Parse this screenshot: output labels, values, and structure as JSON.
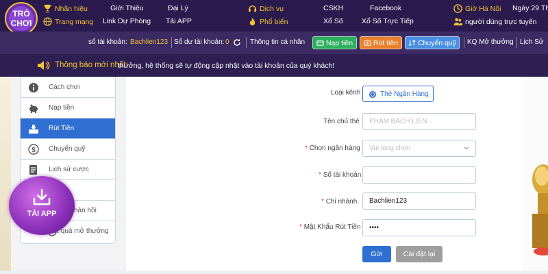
{
  "brand": {
    "logo_text_top": "TRÒ",
    "logo_text_bottom": "CHƠI"
  },
  "topnav": {
    "row1": {
      "nhan_hieu": "Nhãn hiệu",
      "gioi_thieu": "Giới Thiệu",
      "dai_ly": "Đại Lý",
      "dich_vu": "Dịch vụ",
      "cskh": "CSKH",
      "facebook": "Facebook",
      "gio_ha_noi": "Giờ Hà Nội",
      "date": "Ngày 29 Th"
    },
    "row2": {
      "trang_mang": "Trang mạng",
      "link_du_phong": "Link Dự Phòng",
      "tai_app": "Tải APP",
      "pho_bien": "Phổ biến",
      "xo_so": "Xổ Số",
      "xo_so_truc_tiep": "Xổ Số Trực Tiếp",
      "online": "người dùng trực tuyến"
    }
  },
  "userbar": {
    "account_label": "số tài khoản:",
    "account_value": "Bachlien123",
    "balance_label": "Số dư tài khoản:",
    "balance_value": "0",
    "personal_info": "Thông tin cá nhân",
    "deposit": "Nạp tiền",
    "withdraw": "Rút tiền",
    "transfer": "Chuyển quỹ",
    "results": "KQ Mở thưởng",
    "history": "Lịch Sử"
  },
  "notice": {
    "label": "Thông báo mới nhất:",
    "text": "thưởng, hệ thống sẽ tự động cập nhật vào tài khoản của quý khách!"
  },
  "sidebar": {
    "items": [
      {
        "label": "Cách chơi",
        "icon": "info-icon"
      },
      {
        "label": "Nạp tiền",
        "icon": "piggy-bank-icon"
      },
      {
        "label": "Rút Tiền",
        "icon": "withdraw-icon"
      },
      {
        "label": "Chuyển quỹ",
        "icon": "dollar-icon"
      },
      {
        "label": "Lịch sử cược",
        "icon": "history-icon"
      },
      {
        "label": "",
        "icon": ""
      },
      {
        "label": "hản hồi",
        "icon": "feedback-icon"
      },
      {
        "label": "Kết quả mở thưởng",
        "icon": "result-icon"
      }
    ]
  },
  "taiapp": {
    "label": "TẢI APP",
    "icon": "download-icon"
  },
  "form": {
    "channel_label": "Loại kênh",
    "channel_option": "Thẻ Ngân Hàng",
    "holder_label": "Tên chủ thẻ",
    "holder_placeholder": "PHAM BACH LIEN",
    "bank_label": "Chọn ngân hàng",
    "bank_placeholder": "Vui lòng chọn",
    "account_label": "Số tài khoản",
    "account_value": "",
    "branch_label": "Chi nhánh",
    "branch_value": "Bachlien123",
    "password_label": "Mật Khẩu Rút Tiền",
    "password_value": "••••",
    "required_mark": "*",
    "submit": "Gửi",
    "reset": "Cài đặt lại"
  },
  "colors": {
    "nav_bg": "#2b1a4e",
    "userbar_bg": "#3c2a63",
    "accent_gold": "#f1c232",
    "primary_blue": "#2e6fd1",
    "deposit_green": "#2eaf5e",
    "withdraw_orange": "#e8802c",
    "transfer_blue": "#4a90e2",
    "reset_gray": "#9e9e9e"
  }
}
